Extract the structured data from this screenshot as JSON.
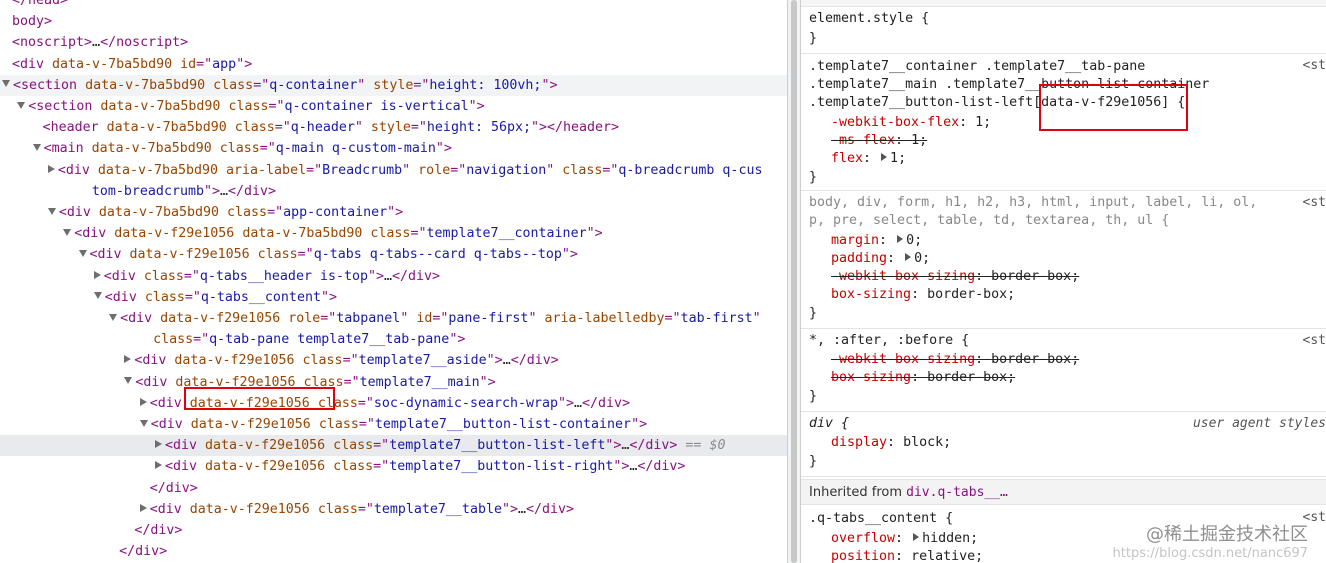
{
  "elements_tree": [
    {
      "indent": 0,
      "tri": "none",
      "parts": [
        [
          "tag",
          "</"
        ],
        [
          "tag",
          "head"
        ],
        [
          "tag",
          ">"
        ]
      ]
    },
    {
      "indent": 0,
      "tri": "none",
      "parts": [
        [
          "tag",
          "body"
        ],
        [
          "tag",
          ">"
        ]
      ]
    },
    {
      "indent": 0,
      "tri": "none",
      "parts": [
        [
          "tag",
          "<noscript>"
        ],
        [
          "tx",
          "…"
        ],
        [
          "tag",
          "</noscript>"
        ]
      ]
    },
    {
      "indent": 0,
      "tri": "none",
      "parts": [
        [
          "tag",
          "<div "
        ],
        [
          "an",
          "data-v-7ba5bd90"
        ],
        [
          "an",
          " id"
        ],
        [
          "tag",
          "=\""
        ],
        [
          "av",
          "app"
        ],
        [
          "tag",
          "\">"
        ]
      ]
    },
    {
      "indent": 0,
      "tri": "open",
      "selected_soft": true,
      "parts": [
        [
          "tag",
          "<section "
        ],
        [
          "an",
          "data-v-7ba5bd90"
        ],
        [
          "an",
          " class"
        ],
        [
          "tag",
          "=\""
        ],
        [
          "av",
          "q-container"
        ],
        [
          "tag",
          "\""
        ],
        [
          "an",
          " style"
        ],
        [
          "tag",
          "=\""
        ],
        [
          "av",
          "height: 100vh;"
        ],
        [
          "tag",
          "\">"
        ]
      ]
    },
    {
      "indent": 1,
      "tri": "open",
      "parts": [
        [
          "tag",
          "<section "
        ],
        [
          "an",
          "data-v-7ba5bd90"
        ],
        [
          "an",
          " class"
        ],
        [
          "tag",
          "=\""
        ],
        [
          "av",
          "q-container is-vertical"
        ],
        [
          "tag",
          "\">"
        ]
      ]
    },
    {
      "indent": 2,
      "tri": "none",
      "parts": [
        [
          "tag",
          "<header "
        ],
        [
          "an",
          "data-v-7ba5bd90"
        ],
        [
          "an",
          " class"
        ],
        [
          "tag",
          "=\""
        ],
        [
          "av",
          "q-header"
        ],
        [
          "tag",
          "\""
        ],
        [
          "an",
          " style"
        ],
        [
          "tag",
          "=\""
        ],
        [
          "av",
          "height: 56px;"
        ],
        [
          "tag",
          "\"></header>"
        ]
      ]
    },
    {
      "indent": 2,
      "tri": "open",
      "parts": [
        [
          "tag",
          "<main "
        ],
        [
          "an",
          "data-v-7ba5bd90"
        ],
        [
          "an",
          " class"
        ],
        [
          "tag",
          "=\""
        ],
        [
          "av",
          "q-main q-custom-main"
        ],
        [
          "tag",
          "\">"
        ]
      ]
    },
    {
      "indent": 3,
      "tri": "closed",
      "parts": [
        [
          "tag",
          "<div "
        ],
        [
          "an",
          "data-v-7ba5bd90"
        ],
        [
          "an",
          " aria-label"
        ],
        [
          "tag",
          "=\""
        ],
        [
          "av",
          "Breadcrumb"
        ],
        [
          "tag",
          "\""
        ],
        [
          "an",
          " role"
        ],
        [
          "tag",
          "=\""
        ],
        [
          "av",
          "navigation"
        ],
        [
          "tag",
          "\""
        ],
        [
          "an",
          " class"
        ],
        [
          "tag",
          "=\""
        ],
        [
          "av",
          "q-breadcrumb q-cus"
        ]
      ]
    },
    {
      "indent": 3,
      "tri": "cont",
      "parts": [
        [
          "av",
          "tom-breadcrumb"
        ],
        [
          "tag",
          "\">"
        ],
        [
          "tx",
          "…"
        ],
        [
          "tag",
          "</div>"
        ]
      ]
    },
    {
      "indent": 3,
      "tri": "open",
      "parts": [
        [
          "tag",
          "<div "
        ],
        [
          "an",
          "data-v-7ba5bd90"
        ],
        [
          "an",
          " class"
        ],
        [
          "tag",
          "=\""
        ],
        [
          "av",
          "app-container"
        ],
        [
          "tag",
          "\">"
        ]
      ]
    },
    {
      "indent": 4,
      "tri": "open",
      "parts": [
        [
          "tag",
          "<div "
        ],
        [
          "an",
          "data-v-f29e1056"
        ],
        [
          "an",
          " data-v-7ba5bd90"
        ],
        [
          "an",
          " class"
        ],
        [
          "tag",
          "=\""
        ],
        [
          "av",
          "template7__container"
        ],
        [
          "tag",
          "\">"
        ]
      ]
    },
    {
      "indent": 5,
      "tri": "open",
      "parts": [
        [
          "tag",
          "<div "
        ],
        [
          "an",
          "data-v-f29e1056"
        ],
        [
          "an",
          " class"
        ],
        [
          "tag",
          "=\""
        ],
        [
          "av",
          "q-tabs q-tabs--card q-tabs--top"
        ],
        [
          "tag",
          "\">"
        ]
      ]
    },
    {
      "indent": 6,
      "tri": "closed",
      "parts": [
        [
          "tag",
          "<div "
        ],
        [
          "an",
          "class"
        ],
        [
          "tag",
          "=\""
        ],
        [
          "av",
          "q-tabs__header is-top"
        ],
        [
          "tag",
          "\">"
        ],
        [
          "tx",
          "…"
        ],
        [
          "tag",
          "</div>"
        ]
      ]
    },
    {
      "indent": 6,
      "tri": "open",
      "parts": [
        [
          "tag",
          "<div "
        ],
        [
          "an",
          "class"
        ],
        [
          "tag",
          "=\""
        ],
        [
          "av",
          "q-tabs__content"
        ],
        [
          "tag",
          "\">"
        ]
      ]
    },
    {
      "indent": 7,
      "tri": "open",
      "parts": [
        [
          "tag",
          "<div "
        ],
        [
          "an",
          "data-v-f29e1056"
        ],
        [
          "an",
          " role"
        ],
        [
          "tag",
          "=\""
        ],
        [
          "av",
          "tabpanel"
        ],
        [
          "tag",
          "\""
        ],
        [
          "an",
          " id"
        ],
        [
          "tag",
          "=\""
        ],
        [
          "av",
          "pane-first"
        ],
        [
          "tag",
          "\""
        ],
        [
          "an",
          " aria-labelledby"
        ],
        [
          "tag",
          "=\""
        ],
        [
          "av",
          "tab-first"
        ],
        [
          "tag",
          "\""
        ]
      ]
    },
    {
      "indent": 7,
      "tri": "cont",
      "parts": [
        [
          "an",
          "class"
        ],
        [
          "tag",
          "=\""
        ],
        [
          "av",
          "q-tab-pane template7__tab-pane"
        ],
        [
          "tag",
          "\">"
        ]
      ]
    },
    {
      "indent": 8,
      "tri": "closed",
      "parts": [
        [
          "tag",
          "<div "
        ],
        [
          "an",
          "data-v-f29e1056"
        ],
        [
          "an",
          " class"
        ],
        [
          "tag",
          "=\""
        ],
        [
          "av",
          "template7__aside"
        ],
        [
          "tag",
          "\">"
        ],
        [
          "tx",
          "…"
        ],
        [
          "tag",
          "</div>"
        ]
      ]
    },
    {
      "indent": 8,
      "tri": "open",
      "parts": [
        [
          "tag",
          "<div "
        ],
        [
          "an",
          "data-v-f29e1056"
        ],
        [
          "an",
          " class"
        ],
        [
          "tag",
          "=\""
        ],
        [
          "av",
          "template7__main"
        ],
        [
          "tag",
          "\">"
        ]
      ]
    },
    {
      "indent": 9,
      "tri": "closed",
      "parts": [
        [
          "tag",
          "<div "
        ],
        [
          "an",
          "data-v-f29e1056"
        ],
        [
          "an",
          " class"
        ],
        [
          "tag",
          "=\""
        ],
        [
          "av",
          "soc-dynamic-search-wrap"
        ],
        [
          "tag",
          "\">"
        ],
        [
          "tx",
          "…"
        ],
        [
          "tag",
          "</div>"
        ]
      ]
    },
    {
      "indent": 9,
      "tri": "open",
      "parts": [
        [
          "tag",
          "<div "
        ],
        [
          "an",
          "data-v-f29e1056"
        ],
        [
          "an",
          " class"
        ],
        [
          "tag",
          "=\""
        ],
        [
          "av",
          "template7__button-list-container"
        ],
        [
          "tag",
          "\">"
        ]
      ]
    },
    {
      "indent": 10,
      "tri": "closed",
      "selected": true,
      "parts": [
        [
          "tag",
          "<div "
        ],
        [
          "an",
          "data-v-f29e1056"
        ],
        [
          "an",
          " class"
        ],
        [
          "tag",
          "=\""
        ],
        [
          "av",
          "template7__button-list-left"
        ],
        [
          "tag",
          "\">"
        ],
        [
          "tx",
          "…"
        ],
        [
          "tag",
          "</div>"
        ],
        [
          "dl",
          " == $0"
        ]
      ]
    },
    {
      "indent": 10,
      "tri": "closed",
      "parts": [
        [
          "tag",
          "<div "
        ],
        [
          "an",
          "data-v-f29e1056"
        ],
        [
          "an",
          " class"
        ],
        [
          "tag",
          "=\""
        ],
        [
          "av",
          "template7__button-list-right"
        ],
        [
          "tag",
          "\">"
        ],
        [
          "tx",
          "…"
        ],
        [
          "tag",
          "</div>"
        ]
      ]
    },
    {
      "indent": 9,
      "tri": "none",
      "parts": [
        [
          "tag",
          "</div>"
        ]
      ]
    },
    {
      "indent": 9,
      "tri": "closed",
      "parts": [
        [
          "tag",
          "<div "
        ],
        [
          "an",
          "data-v-f29e1056"
        ],
        [
          "an",
          " class"
        ],
        [
          "tag",
          "=\""
        ],
        [
          "av",
          "template7__table"
        ],
        [
          "tag",
          "\">"
        ],
        [
          "tx",
          "…"
        ],
        [
          "tag",
          "</div>"
        ]
      ]
    },
    {
      "indent": 8,
      "tri": "none",
      "parts": [
        [
          "tag",
          "</div>"
        ]
      ]
    },
    {
      "indent": 7,
      "tri": "none",
      "parts": [
        [
          "tag",
          "</div>"
        ]
      ]
    },
    {
      "indent": 7,
      "tri": "none",
      "parts": [
        [
          "tag",
          "</div>"
        ]
      ]
    }
  ],
  "styles": {
    "element_style": {
      "selector": "element.style {",
      "close": "}"
    },
    "rule1": {
      "sel_line1": ".template7__container .template7__tab-pane",
      "sel_line2": ".template7__main .template7__button-list-container",
      "sel_line3a": ".template7__button-list-left",
      "sel_line3b": "[data-v-f29e1056]",
      "sel_line3c": " {",
      "source": "<st",
      "props": [
        {
          "name": "-webkit-box-flex",
          "value": "1",
          "strike": false,
          "expander": false
        },
        {
          "name": "-ms-flex",
          "value": "1",
          "strike": true,
          "expander": false
        },
        {
          "name": "flex",
          "value": "1",
          "strike": false,
          "expander": true
        }
      ],
      "close": "}"
    },
    "rule2": {
      "sel_line1": "body, div, form, h1, h2, h3, html, input, label, li, ol,",
      "sel_line2": "p, pre, select, table, td, textarea, th, ul {",
      "source": "<st",
      "props": [
        {
          "name": "margin",
          "value": "0",
          "strike": false,
          "expander": true
        },
        {
          "name": "padding",
          "value": "0",
          "strike": false,
          "expander": true
        },
        {
          "name": "-webkit-box-sizing",
          "value": "border-box",
          "strike": true,
          "expander": false
        },
        {
          "name": "box-sizing",
          "value": "border-box",
          "strike": false,
          "expander": false
        }
      ],
      "close": "}"
    },
    "rule3": {
      "sel_line1": "*, :after, :before {",
      "source": "<st",
      "props": [
        {
          "name": "-webkit-box-sizing",
          "value": "border-box",
          "strike": true,
          "expander": false
        },
        {
          "name": "box-sizing",
          "value": "border-box",
          "strike": true,
          "expander": false
        }
      ],
      "close": "}"
    },
    "rule4": {
      "sel_line1": "div {",
      "source": "user agent styles",
      "props": [
        {
          "name": "display",
          "value": "block",
          "strike": false,
          "expander": false
        }
      ],
      "close": "}"
    },
    "inherited": {
      "label": "Inherited from",
      "ref": "div.q-tabs__…"
    },
    "rule5": {
      "sel_line1": ".q-tabs__content {",
      "source": "<st",
      "props": [
        {
          "name": "overflow",
          "value": "hidden",
          "strike": false,
          "expander": true
        },
        {
          "name": "position",
          "value": "relative",
          "strike": false,
          "expander": false
        }
      ]
    }
  },
  "watermark": {
    "line1": "@稀土掘金技术社区",
    "line2": "https://blog.csdn.net/nanc697"
  }
}
